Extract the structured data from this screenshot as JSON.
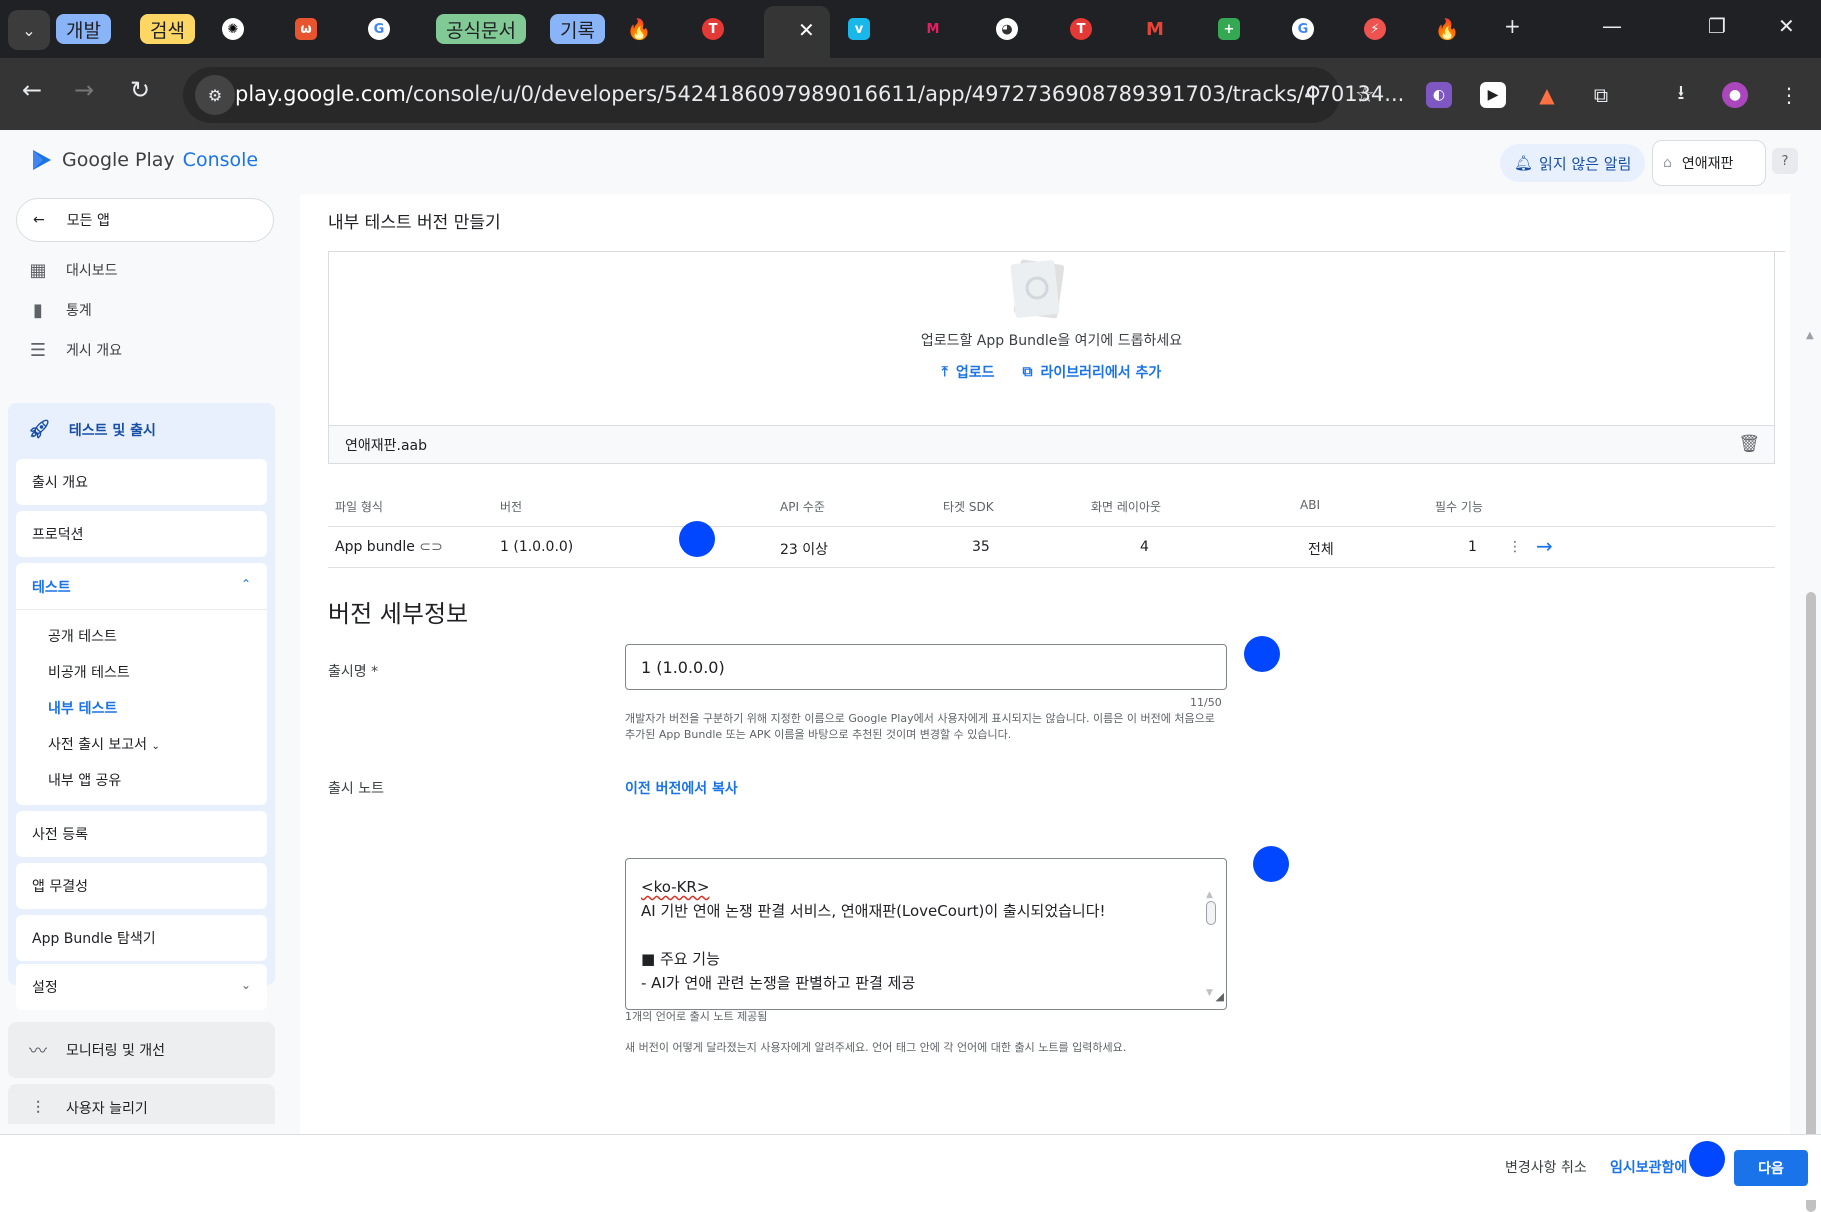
{
  "browser": {
    "tab_groups": [
      {
        "label": "개발",
        "color": "#8ab4f8"
      },
      {
        "label": "검색",
        "color": "#fdd663"
      },
      {
        "label": "공식문서",
        "color": "#81c995"
      },
      {
        "label": "기록",
        "color": "#8ab4f8"
      }
    ],
    "url_host": "play.google.com",
    "url_path": "/console/u/0/developers/5424186097989016611/app/4972736908789391703/tracks/470134...",
    "new_tab_label": "+"
  },
  "header": {
    "logo_text": "Google Play",
    "logo_console": "Console",
    "notifications_label": "읽지 않은 알림",
    "app_name": "연애재판"
  },
  "sidebar": {
    "back_label": "모든 앱",
    "top_items": [
      {
        "label": "대시보드",
        "icon": "dashboard-icon"
      },
      {
        "label": "통계",
        "icon": "bar-chart-icon"
      },
      {
        "label": "게시 개요",
        "icon": "publishing-overview-icon"
      }
    ],
    "test_release": {
      "title": "테스트 및 출시",
      "items": {
        "release_overview": "출시 개요",
        "production": "프로덕션",
        "testing": "테스트",
        "testing_sub": [
          "공개 테스트",
          "비공개 테스트",
          "내부 테스트",
          "사전 출시 보고서",
          "내부 앱 공유"
        ],
        "pre_registration": "사전 등록",
        "app_integrity": "앱 무결성",
        "bundle_explorer": "App Bundle 탐색기",
        "settings": "설정"
      }
    },
    "monitoring": "모니터링 및 개선",
    "grow_users": "사용자 늘리기"
  },
  "main": {
    "title": "내부 테스트 버전 만들기",
    "upload": {
      "drop_text": "업로드할 App Bundle을 여기에 드롭하세요",
      "upload_label": "업로드",
      "library_label": "라이브러리에서 추가"
    },
    "file_name": "연애재판.aab",
    "table": {
      "headers": [
        "파일 형식",
        "버전",
        "API 수준",
        "타겟 SDK",
        "화면 레이아웃",
        "ABI",
        "필수 기능"
      ],
      "row": [
        "App bundle",
        "1 (1.0.0.0)",
        "23 이상",
        "35",
        "4",
        "전체",
        "1"
      ]
    },
    "version_details_title": "버전 세부정보",
    "release_name_label": "출시명 *",
    "release_name_value": "1 (1.0.0.0)",
    "release_name_counter": "11/50",
    "release_name_help": "개발자가 버전을 구분하기 위해 지정한 이름으로 Google Play에서 사용자에게 표시되지는 않습니다. 이름은 이 버전에 처음으로 추가된 App Bundle 또는 APK 이름을 바탕으로 추천된 것이며 변경할 수 있습니다.",
    "release_notes_label": "출시 노트",
    "copy_previous_label": "이전 버전에서 복사",
    "release_notes_lines": [
      "<ko-KR>",
      "AI 기반 연애 논쟁 판결 서비스, 연애재판(LoveCourt)이 출시되었습니다!",
      "",
      "■ 주요 기능",
      "- AI가 연애 관련 논쟁을 판별하고 판결 제공"
    ],
    "languages_note": "1개의 언어로 출시 노트 제공됨",
    "release_notes_help": "새 버전이 어떻게 달라졌는지 사용자에게 알려주세요. 언어 태그 안에 각 언어에 대한 출시 노트를 입력하세요."
  },
  "footer": {
    "discard_label": "변경사항 취소",
    "save_draft_label": "임시보관함에",
    "next_label": "다음"
  },
  "colors": {
    "accent": "#1a73e8",
    "marker": "#0047ff"
  }
}
